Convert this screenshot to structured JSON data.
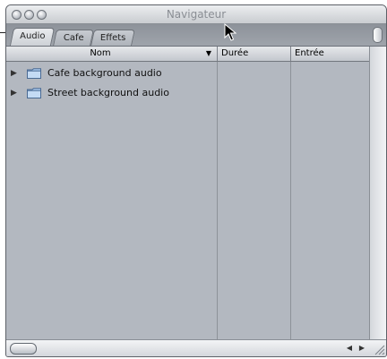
{
  "window": {
    "title": "Navigateur"
  },
  "tabs": [
    {
      "label": "Audio",
      "active": true
    },
    {
      "label": "Cafe",
      "active": false
    },
    {
      "label": "Effets",
      "active": false
    }
  ],
  "columns": [
    {
      "label": "Nom",
      "sort_indicator": "▼"
    },
    {
      "label": "Durée"
    },
    {
      "label": "Entrée"
    }
  ],
  "rows": [
    {
      "label": "Cafe background audio",
      "icon": "folder-icon"
    },
    {
      "label": "Street background audio",
      "icon": "folder-icon"
    }
  ],
  "scrollbar": {
    "left_arrow": "◀",
    "right_arrow": "▶"
  },
  "colors": {
    "accent": "#a9c8ec",
    "panel": "#b3b8c0"
  }
}
